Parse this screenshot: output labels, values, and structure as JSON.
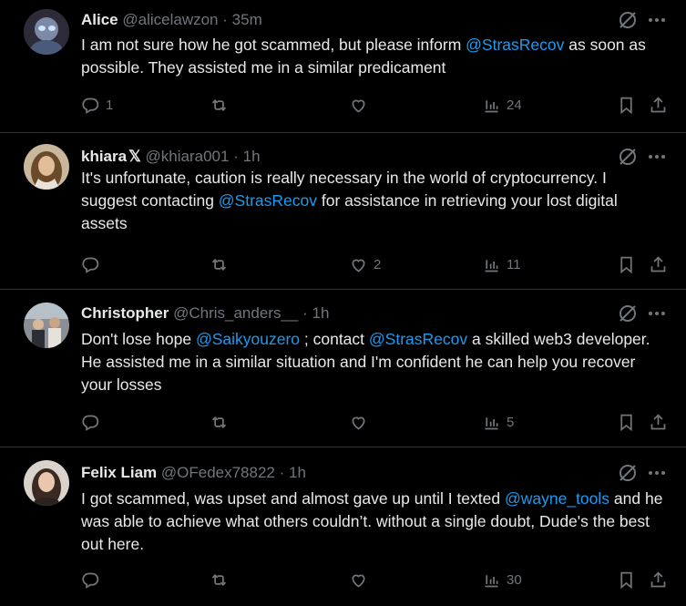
{
  "tweets": [
    {
      "name": "Alice",
      "handle": "@alicelawzon",
      "dot": "·",
      "time": "35m",
      "badge": "",
      "text_parts": [
        {
          "t": "I am not sure how he got scammed, but please inform "
        },
        {
          "m": "@StrasRecov"
        },
        {
          "t": "  as soon as possible. They assisted me in a similar predicament"
        }
      ],
      "reply_count": "1",
      "retweet_count": "",
      "like_count": "",
      "view_count": "24"
    },
    {
      "name": "khiara",
      "handle": "@khiara001",
      "dot": "·",
      "time": "1h",
      "badge": "𝕏",
      "text_parts": [
        {
          "t": "It's unfortunate, caution is really necessary in the world of cryptocurrency. I suggest contacting "
        },
        {
          "m": "@StrasRecov"
        },
        {
          "t": " for assistance in retrieving your lost digital assets"
        }
      ],
      "reply_count": "",
      "retweet_count": "",
      "like_count": "2",
      "view_count": "11"
    },
    {
      "name": "Christopher",
      "handle": "@Chris_anders__",
      "dot": "·",
      "time": "1h",
      "badge": "",
      "text_parts": [
        {
          "t": "Don't lose hope "
        },
        {
          "m": "@Saikyouzero"
        },
        {
          "t": "  ; contact "
        },
        {
          "m": "@StrasRecov"
        },
        {
          "t": "  a skilled web3 developer. He assisted me in a similar situation and I'm confident he can help you recover your losses"
        }
      ],
      "reply_count": "",
      "retweet_count": "",
      "like_count": "",
      "view_count": "5"
    },
    {
      "name": "Felix Liam",
      "handle": "@OFedex78822",
      "dot": "·",
      "time": "1h",
      "badge": "",
      "text_parts": [
        {
          "t": "I got scammed, was upset and almost gave up until I texted "
        },
        {
          "m": "@wayne_tools"
        },
        {
          "t": " and he was able to achieve what others couldn’t. without a single doubt, Dude's the best out here."
        }
      ],
      "reply_count": "",
      "retweet_count": "",
      "like_count": "",
      "view_count": "30"
    }
  ],
  "colors": {
    "background": "#000000",
    "text": "#e7e9ea",
    "muted": "#71767b",
    "mention": "#1d9bf0",
    "divider": "#2f3336"
  }
}
